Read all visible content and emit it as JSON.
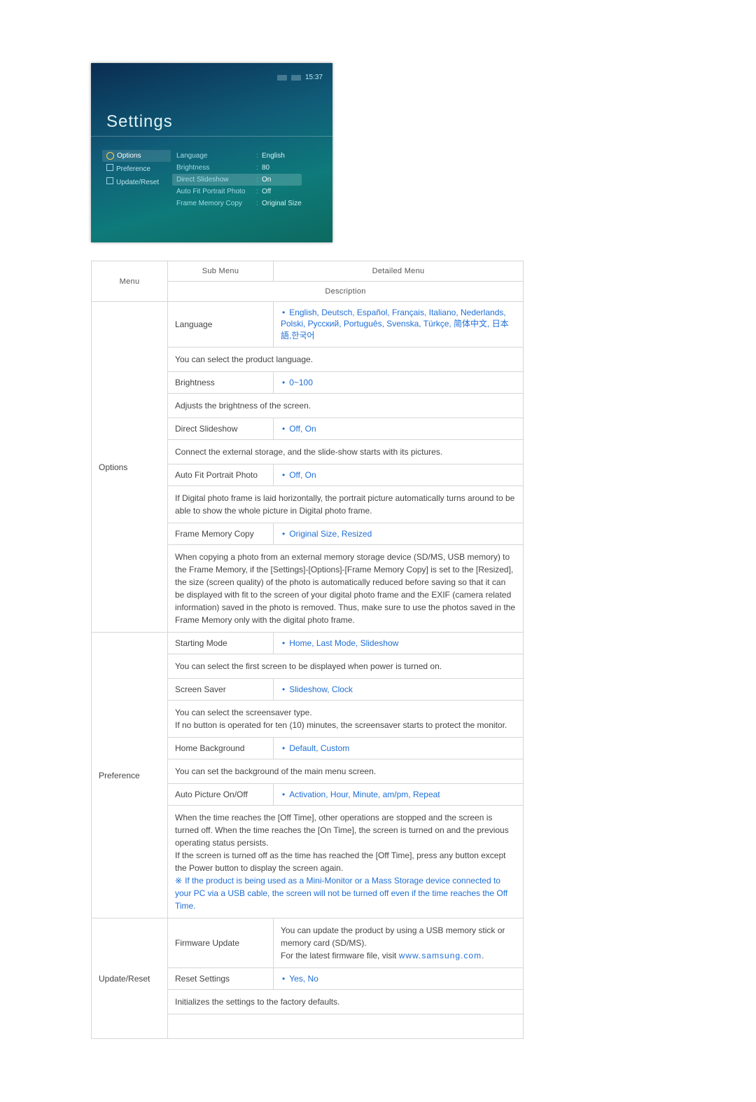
{
  "device": {
    "time": "15:37",
    "title": "Settings",
    "side_items": [
      "Options",
      "Preference",
      "Update/Reset"
    ],
    "rows": [
      {
        "k": "Language",
        "v": "English"
      },
      {
        "k": "Brightness",
        "v": "80"
      },
      {
        "k": "Direct Slideshow",
        "v": "On",
        "hl": true
      },
      {
        "k": "Auto Fit Portrait Photo",
        "v": "Off"
      },
      {
        "k": "Frame Memory Copy",
        "v": "Original Size"
      }
    ]
  },
  "table": {
    "head": {
      "menu": "Menu",
      "sub": "Sub Menu",
      "detail": "Detailed Menu",
      "desc": "Description"
    },
    "options": {
      "name": "Options",
      "language": {
        "label": "Language",
        "value": "English, Deutsch, Español, Français, Italiano, Nederlands, Polski, Русский, Português, Svenska, Türkçe, 简体中文, 日本語,한국어",
        "desc": "You can select the product language."
      },
      "brightness": {
        "label": "Brightness",
        "value": "0~100",
        "desc": "Adjusts the brightness of the screen."
      },
      "direct": {
        "label": "Direct Slideshow",
        "value": "Off, On",
        "desc": "Connect the external storage, and the slide-show starts with its pictures."
      },
      "autofit": {
        "label": "Auto Fit Portrait Photo",
        "value": "Off, On",
        "desc": "If Digital photo frame is laid horizontally, the portrait picture automatically turns around to be able to show the whole picture in Digital photo frame."
      },
      "framecopy": {
        "label": "Frame Memory Copy",
        "value": "Original Size, Resized",
        "desc": "When copying a photo from an external memory storage device (SD/MS, USB memory) to the Frame Memory, if the [Settings]-[Options]-[Frame Memory Copy] is set to the [Resized], the size (screen quality) of the photo is automatically reduced before saving so that it can be displayed with fit to the screen of your digital photo frame and the EXIF (camera related information) saved in the photo is removed. Thus, make sure to use the photos saved in the Frame Memory only with the digital photo frame."
      }
    },
    "preference": {
      "name": "Preference",
      "startmode": {
        "label": "Starting Mode",
        "value": "Home, Last Mode, Slideshow",
        "desc": "You can select the first screen to be displayed when power is turned on."
      },
      "screensaver": {
        "label": "Screen Saver",
        "value": "Slideshow, Clock",
        "desc": "You can select the screensaver type.\nIf no button is operated for ten (10) minutes, the screensaver starts to protect the monitor."
      },
      "homebg": {
        "label": "Home Background",
        "value": "Default, Custom",
        "desc": "You can set the background of the main menu screen."
      },
      "autopic": {
        "label": "Auto Picture On/Off",
        "value": "Activation, Hour, Minute, am/pm, Repeat",
        "desc": "When the time reaches the [Off Time], other operations are stopped and the screen is turned off. When the time reaches the [On Time], the screen is turned on and the previous operating status persists.\nIf the screen is turned off as the time has reached the [Off Time], press any button except the Power button to display the screen again.",
        "note": "If the product is being used as a Mini-Monitor or a Mass Storage device connected to your PC via a USB cable, the screen will not be turned off even if the time reaches the Off Time."
      }
    },
    "update": {
      "name": "Update/Reset",
      "firmware": {
        "label": "Firmware Update",
        "desc_a": "You can update the product by using a USB memory stick or memory card (SD/MS).",
        "desc_b": "For the latest firmware file, visit ",
        "url": "www.samsung.com",
        "tail": "."
      },
      "reset": {
        "label": "Reset Settings",
        "value": "Yes, No",
        "desc": "Initializes the settings to the factory defaults."
      }
    }
  }
}
